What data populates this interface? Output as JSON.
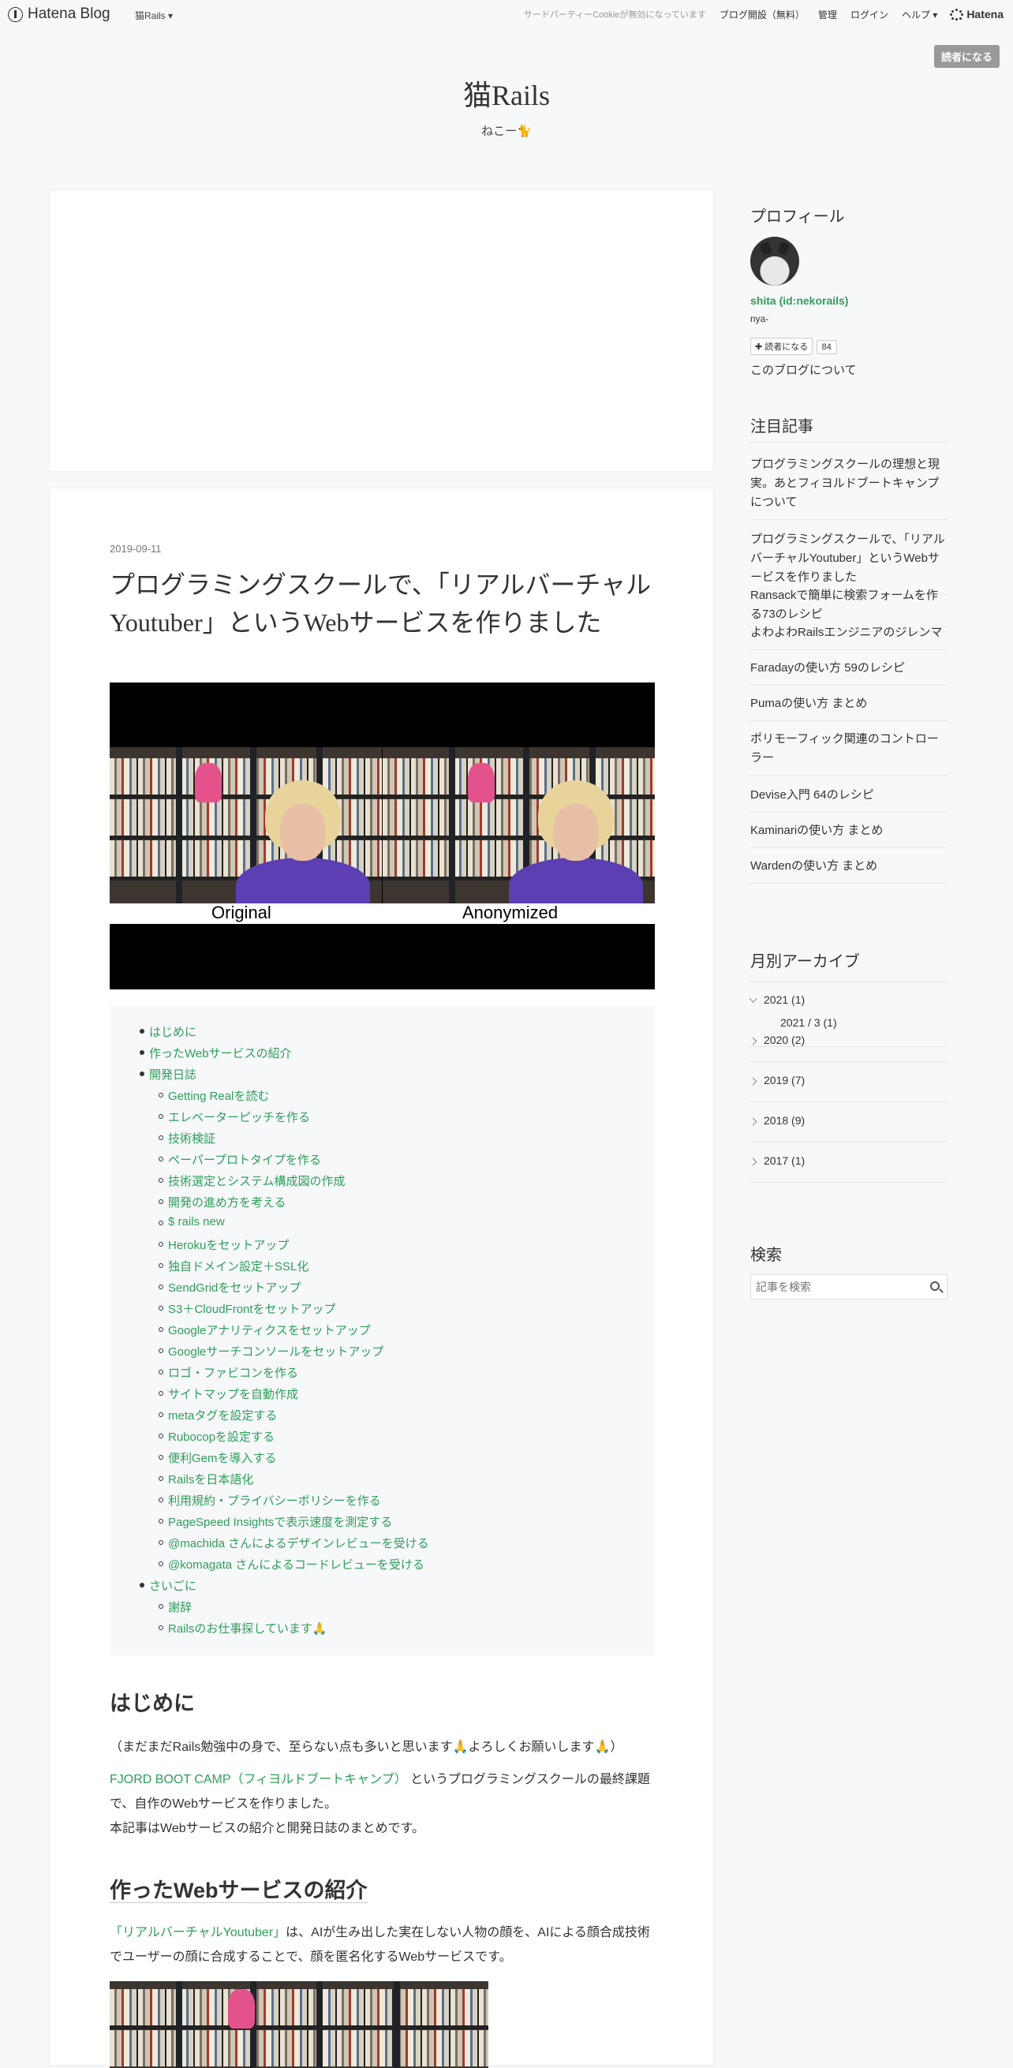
{
  "global_header": {
    "logo_text": "Hatena Blog",
    "blog_menu": "猫Rails ▾",
    "cookie_notice": "サードパーティーCookieが無効になっています",
    "open_blog": "ブログ開設（無料）",
    "admin": "管理",
    "login": "ログイン",
    "help": "ヘルプ ▾",
    "hatena": "Hatena"
  },
  "subscribe_top": "読者になる",
  "blog": {
    "title": "猫Rails",
    "description": "ねこー🐈"
  },
  "entry": {
    "date": "2019-09-11",
    "title": "プログラミングスクールで、「リアルバーチャルYoutuber」というWebサービスを作りました",
    "eyecatch": {
      "left_caption": "Original",
      "right_caption": "Anonymized"
    },
    "toc": [
      {
        "level": 1,
        "label": "はじめに"
      },
      {
        "level": 1,
        "label": "作ったWebサービスの紹介"
      },
      {
        "level": 1,
        "label": "開発日誌"
      },
      {
        "level": 2,
        "label": "Getting Realを読む"
      },
      {
        "level": 2,
        "label": "エレベーターピッチを作る"
      },
      {
        "level": 2,
        "label": "技術検証"
      },
      {
        "level": 2,
        "label": "ペーパープロトタイプを作る"
      },
      {
        "level": 2,
        "label": "技術選定とシステム構成図の作成"
      },
      {
        "level": 2,
        "label": "開発の進め方を考える"
      },
      {
        "level": 2,
        "label": "$ rails new"
      },
      {
        "level": 2,
        "label": "Herokuをセットアップ"
      },
      {
        "level": 2,
        "label": "独自ドメイン設定＋SSL化"
      },
      {
        "level": 2,
        "label": "SendGridをセットアップ"
      },
      {
        "level": 2,
        "label": "S3＋CloudFrontをセットアップ"
      },
      {
        "level": 2,
        "label": "Googleアナリティクスをセットアップ"
      },
      {
        "level": 2,
        "label": "Googleサーチコンソールをセットアップ"
      },
      {
        "level": 2,
        "label": "ロゴ・ファビコンを作る"
      },
      {
        "level": 2,
        "label": "サイトマップを自動作成"
      },
      {
        "level": 2,
        "label": "metaタグを設定する"
      },
      {
        "level": 2,
        "label": "Rubocopを設定する"
      },
      {
        "level": 2,
        "label": "便利Gemを導入する"
      },
      {
        "level": 2,
        "label": "Railsを日本語化"
      },
      {
        "level": 2,
        "label": "利用規約・プライバシーポリシーを作る"
      },
      {
        "level": 2,
        "label": "PageSpeed Insightsで表示速度を測定する"
      },
      {
        "level": 2,
        "label": "@machida さんによるデザインレビューを受ける"
      },
      {
        "level": 2,
        "label": "@komagata さんによるコードレビューを受ける"
      },
      {
        "level": 1,
        "label": "さいごに"
      },
      {
        "level": 2,
        "label": "謝辞"
      },
      {
        "level": 2,
        "label": "Railsのお仕事探しています🙏"
      }
    ],
    "section1": {
      "heading": "はじめに",
      "p1": "（まだまだRails勉強中の身で、至らない点も多いと思います🙏よろしくお願いします🙏）",
      "p2_link": "FJORD BOOT CAMP（フィヨルドブートキャンプ）",
      "p2_rest": " というプログラミングスクールの最終課題で、自作のWebサービスを作りました。",
      "p3": "本記事はWebサービスの紹介と開発日誌のまとめです。"
    },
    "section2": {
      "heading": "作ったWebサービスの紹介",
      "p1_link": "「リアルバーチャルYoutuber」",
      "p1_rest": "は、AIが生み出した実在しない人物の顔を、AIによる顔合成技術でユーザーの顔に合成することで、顔を匿名化するWebサービスです。"
    }
  },
  "sidebar": {
    "profile": {
      "heading": "プロフィール",
      "id": "shita (id:nekorails)",
      "bio": "nya-",
      "subscribe": "読者になる",
      "count": "84",
      "about": "このブログについて"
    },
    "popular": {
      "heading": "注目記事",
      "items": [
        "プログラミングスクールの理想と現実。あとフィヨルドブートキャンプについて",
        "プログラミングスクールで、「リアルバーチャルYoutuber」というWebサービスを作りました",
        "Ransackで簡単に検索フォームを作る73のレシピ",
        "よわよわRailsエンジニアのジレンマ",
        "Faradayの使い方 59のレシピ",
        "Pumaの使い方 まとめ",
        "ポリモーフィック関連のコントローラー",
        "Devise入門 64のレシピ",
        "Kaminariの使い方 まとめ",
        "Wardenの使い方 まとめ"
      ]
    },
    "archive": {
      "heading": "月別アーカイブ",
      "years": [
        "2021 (1)",
        "2020 (2)",
        "2019 (7)",
        "2018 (9)",
        "2017 (1)"
      ],
      "sub": "2021 / 3 (1)"
    },
    "search": {
      "heading": "検索",
      "placeholder": "記事を検索"
    }
  }
}
